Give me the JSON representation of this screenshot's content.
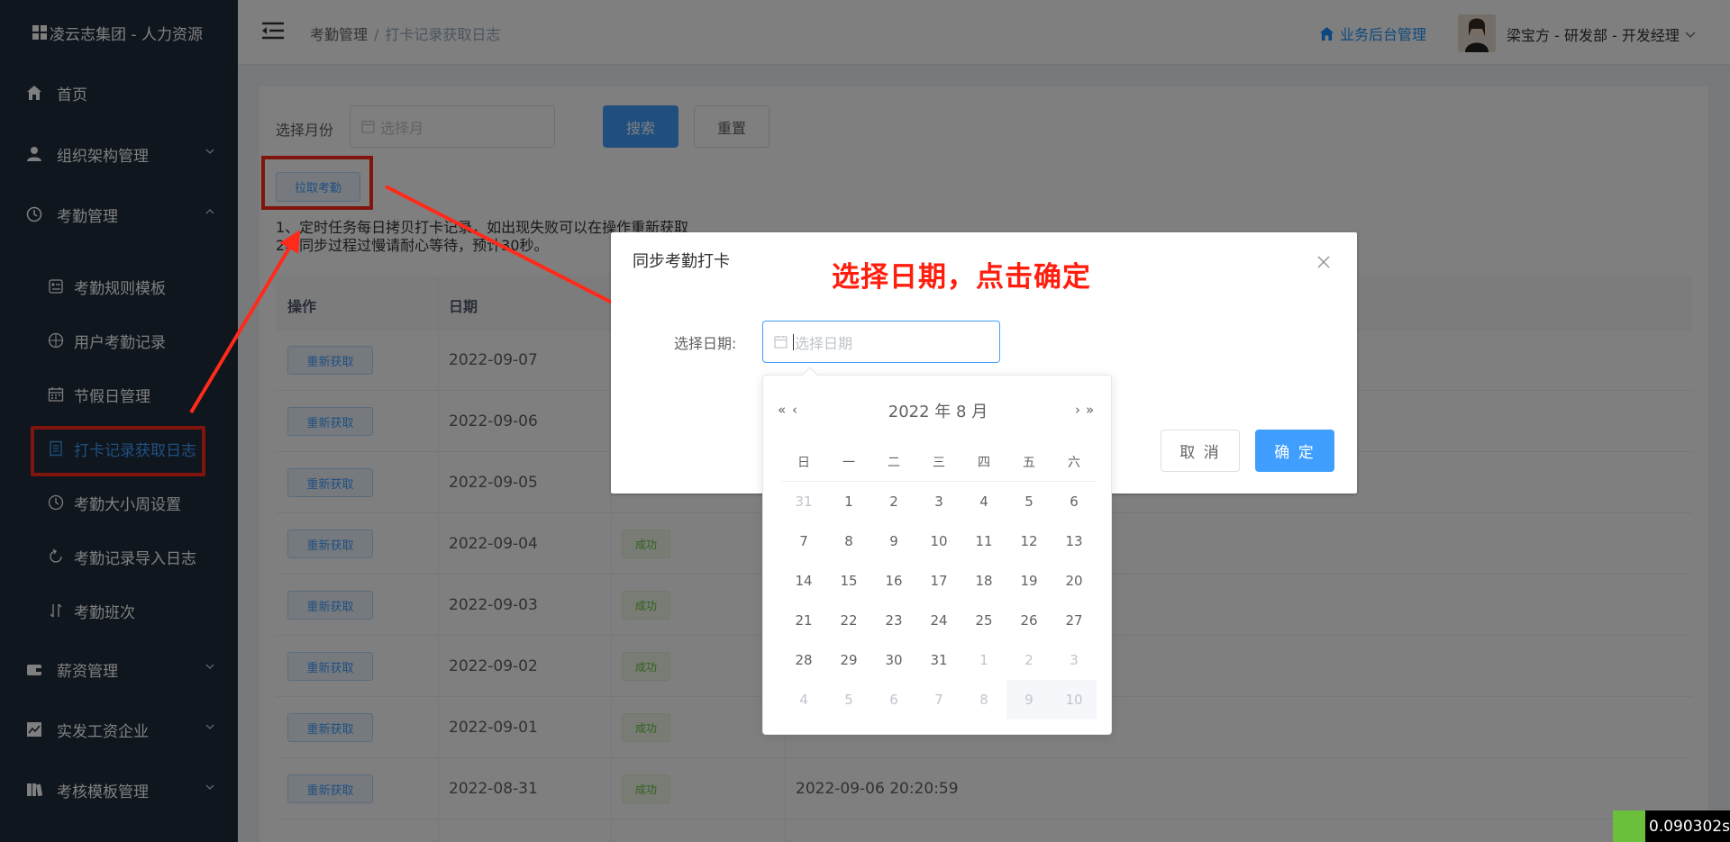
{
  "app": {
    "title": "凌云志集团 - 人力资源"
  },
  "sidebar": {
    "items": [
      {
        "label": "首页",
        "icon": "home-icon"
      },
      {
        "label": "组织架构管理",
        "icon": "user-icon"
      },
      {
        "label": "考勤管理",
        "icon": "clock-icon"
      },
      {
        "label": "薪资管理",
        "icon": "wallet-icon"
      },
      {
        "label": "实发工资企业",
        "icon": "chart-icon"
      },
      {
        "label": "考核模板管理",
        "icon": "book-icon"
      }
    ],
    "sub_items": [
      {
        "label": "考勤规则模板",
        "icon": "rule-template-icon"
      },
      {
        "label": "用户考勤记录",
        "icon": "compass-icon"
      },
      {
        "label": "节假日管理",
        "icon": "calendar-icon"
      },
      {
        "label": "打卡记录获取日志",
        "icon": "document-icon"
      },
      {
        "label": "考勤大小周设置",
        "icon": "clock-icon"
      },
      {
        "label": "考勤记录导入日志",
        "icon": "refresh-icon"
      },
      {
        "label": "考勤班次",
        "icon": "sort-icon"
      }
    ]
  },
  "header": {
    "breadcrumb": [
      "考勤管理",
      "打卡记录获取日志"
    ],
    "breadcrumb_sep": "/",
    "biz_link": "业务后台管理",
    "user": "梁宝方 - 研发部 - 开发经理"
  },
  "search": {
    "month_label": "选择月份",
    "month_placeholder": "选择月",
    "search_btn": "搜索",
    "reset_btn": "重置"
  },
  "pull_btn": "拉取考勤",
  "notes": [
    "1、定时任务每日拷贝打卡记录，如出现失败可以在操作重新获取",
    "2、同步过程过慢请耐心等待，预计30秒。"
  ],
  "table": {
    "headers": [
      "操作",
      "日期"
    ],
    "rows": [
      {
        "op": "重新获取",
        "date": "2022-09-07",
        "status": "",
        "time": ""
      },
      {
        "op": "重新获取",
        "date": "2022-09-06",
        "status": "",
        "time": ""
      },
      {
        "op": "重新获取",
        "date": "2022-09-05",
        "status": "",
        "time": ""
      },
      {
        "op": "重新获取",
        "date": "2022-09-04",
        "status": "成功",
        "time": ""
      },
      {
        "op": "重新获取",
        "date": "2022-09-03",
        "status": "成功",
        "time": ""
      },
      {
        "op": "重新获取",
        "date": "2022-09-02",
        "status": "成功",
        "time": ""
      },
      {
        "op": "重新获取",
        "date": "2022-09-01",
        "status": "成功",
        "time": ""
      },
      {
        "op": "重新获取",
        "date": "2022-08-31",
        "status": "成功",
        "time": "2022-09-06 20:20:59"
      }
    ]
  },
  "dialog": {
    "title": "同步考勤打卡",
    "annotation": "选择日期，点击确定",
    "date_label": "选择日期:",
    "date_placeholder": "选择日期",
    "cancel": "取 消",
    "ok": "确 定"
  },
  "picker": {
    "title": "2022 年  8 月",
    "prev_year": "«",
    "prev_month": "‹",
    "next_month": "›",
    "next_year": "»",
    "weekdays": [
      "日",
      "一",
      "二",
      "三",
      "四",
      "五",
      "六"
    ],
    "days": [
      {
        "d": "31",
        "k": "other"
      },
      {
        "d": "1"
      },
      {
        "d": "2"
      },
      {
        "d": "3"
      },
      {
        "d": "4"
      },
      {
        "d": "5"
      },
      {
        "d": "6"
      },
      {
        "d": "7"
      },
      {
        "d": "8"
      },
      {
        "d": "9"
      },
      {
        "d": "10"
      },
      {
        "d": "11"
      },
      {
        "d": "12"
      },
      {
        "d": "13"
      },
      {
        "d": "14"
      },
      {
        "d": "15"
      },
      {
        "d": "16"
      },
      {
        "d": "17"
      },
      {
        "d": "18"
      },
      {
        "d": "19"
      },
      {
        "d": "20"
      },
      {
        "d": "21"
      },
      {
        "d": "22"
      },
      {
        "d": "23"
      },
      {
        "d": "24"
      },
      {
        "d": "25"
      },
      {
        "d": "26"
      },
      {
        "d": "27"
      },
      {
        "d": "28"
      },
      {
        "d": "29"
      },
      {
        "d": "30"
      },
      {
        "d": "31"
      },
      {
        "d": "1",
        "k": "other"
      },
      {
        "d": "2",
        "k": "other"
      },
      {
        "d": "3",
        "k": "other"
      },
      {
        "d": "4",
        "k": "other"
      },
      {
        "d": "5",
        "k": "other"
      },
      {
        "d": "6",
        "k": "other"
      },
      {
        "d": "7",
        "k": "other"
      },
      {
        "d": "8",
        "k": "other"
      },
      {
        "d": "9",
        "k": "disabled"
      },
      {
        "d": "10",
        "k": "disabled"
      }
    ]
  },
  "timer": "0.090302s",
  "colors": {
    "sidebar_bg": "#1f2d3d",
    "primary": "#409eff",
    "success": "#67c23a",
    "annotation_red": "#ff1e0e"
  }
}
